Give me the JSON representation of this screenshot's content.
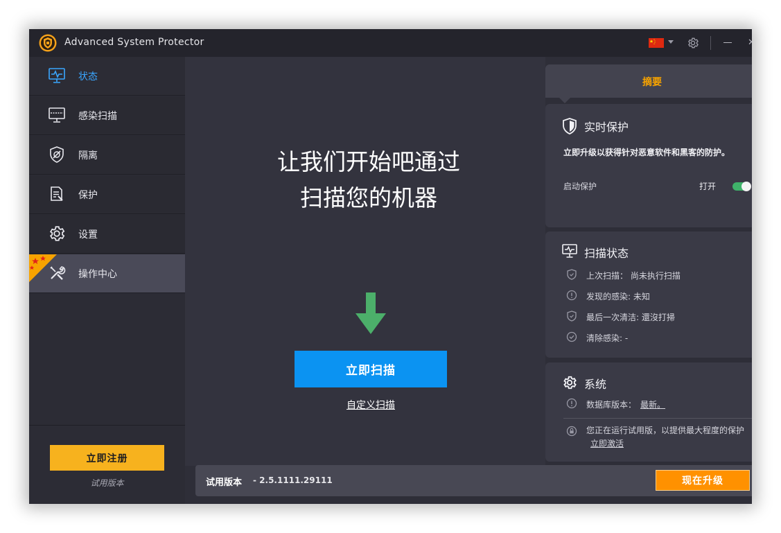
{
  "window": {
    "title": "Advanced System Protector"
  },
  "sidebar": {
    "items": [
      {
        "label": "状态",
        "icon": "monitor-pulse-icon"
      },
      {
        "label": "感染扫描",
        "icon": "scan-monitor-icon"
      },
      {
        "label": "隔离",
        "icon": "quarantine-shield-icon"
      },
      {
        "label": "保护",
        "icon": "protect-document-icon"
      },
      {
        "label": "设置",
        "icon": "gear-icon"
      },
      {
        "label": "操作中心",
        "icon": "tools-icon"
      }
    ],
    "register_label": "立即注册",
    "trial_label": "试用版本"
  },
  "main": {
    "headline": "让我们开始吧通过扫描您的机器",
    "scan_button": "立即扫描",
    "custom_scan": "自定义扫描"
  },
  "footer": {
    "version_label": "试用版本",
    "version_number": "- 2.5.1111.29111",
    "upgrade_button": "现在升级"
  },
  "summary": {
    "tab_label": "摘要",
    "realtime": {
      "title": "实时保护",
      "description": "立即升级以获得针对恶意软件和黑客的防护。",
      "enable_label": "启动保护",
      "state_label": "打开",
      "enabled": true
    },
    "scan_status": {
      "title": "扫描状态",
      "rows": [
        {
          "text": "上次扫描： 尚未执行扫描"
        },
        {
          "text": "发现的感染: 未知"
        },
        {
          "text": "最后一次清洁: 還沒打掃"
        },
        {
          "text": "清除感染: -"
        }
      ]
    },
    "system": {
      "title": "系统",
      "db_label": "数据库版本：",
      "db_value": "最新。",
      "trial_note": "您正在运行试用版，以提供最大程度的保护",
      "activate_link": "立即激活"
    }
  },
  "colors": {
    "accent_blue": "#0b93f2",
    "register_yellow": "#f7b21e",
    "upgrade_orange": "#ff9100",
    "summary_orange": "#f7a300",
    "toggle_green": "#3fb26a"
  }
}
